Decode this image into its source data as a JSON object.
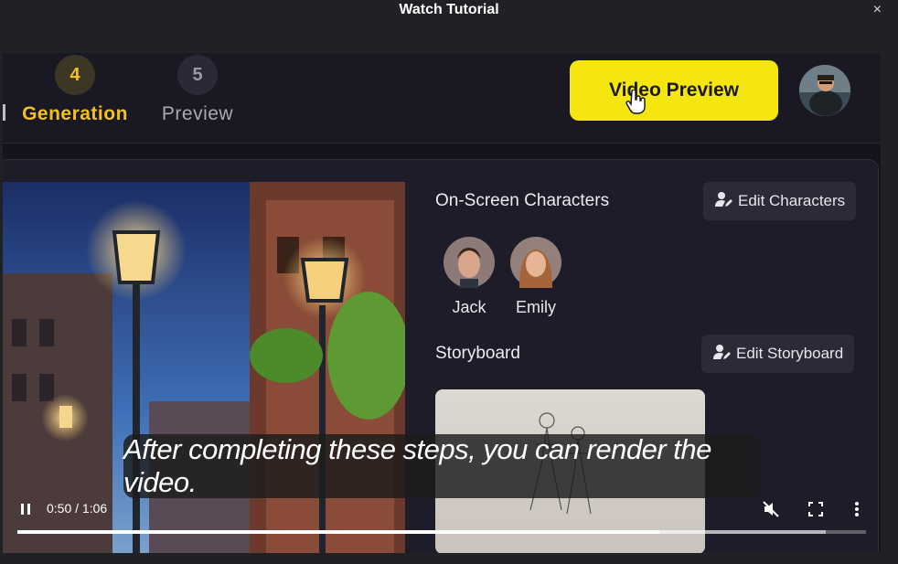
{
  "modal": {
    "title": "Watch Tutorial",
    "close_label": "×"
  },
  "app": {
    "steps": [
      {
        "number": "4",
        "label": "Generation",
        "state": "active"
      },
      {
        "number": "5",
        "label": "Preview",
        "state": "inactive"
      }
    ],
    "video_preview_label": "Video Preview",
    "characters": {
      "title": "On-Screen Characters",
      "edit_label": "Edit Characters",
      "list": [
        {
          "name": "Jack"
        },
        {
          "name": "Emily"
        }
      ]
    },
    "storyboard": {
      "title": "Storyboard",
      "edit_label": "Edit Storyboard"
    }
  },
  "player": {
    "caption": "After completing these steps, you can render the video.",
    "time_display": "0:50 / 1:06",
    "progress_fraction": 0.757,
    "buffered_fraction": 0.953,
    "muted": true
  },
  "colors": {
    "accent_yellow": "#f5e60f",
    "step_active": "#f2c11d",
    "panel_bg": "#1d1c28"
  },
  "icons": [
    "close-icon",
    "hand-cursor-icon",
    "user-edit-icon",
    "pause-icon",
    "volume-muted-icon",
    "fullscreen-icon",
    "more-vert-icon"
  ]
}
